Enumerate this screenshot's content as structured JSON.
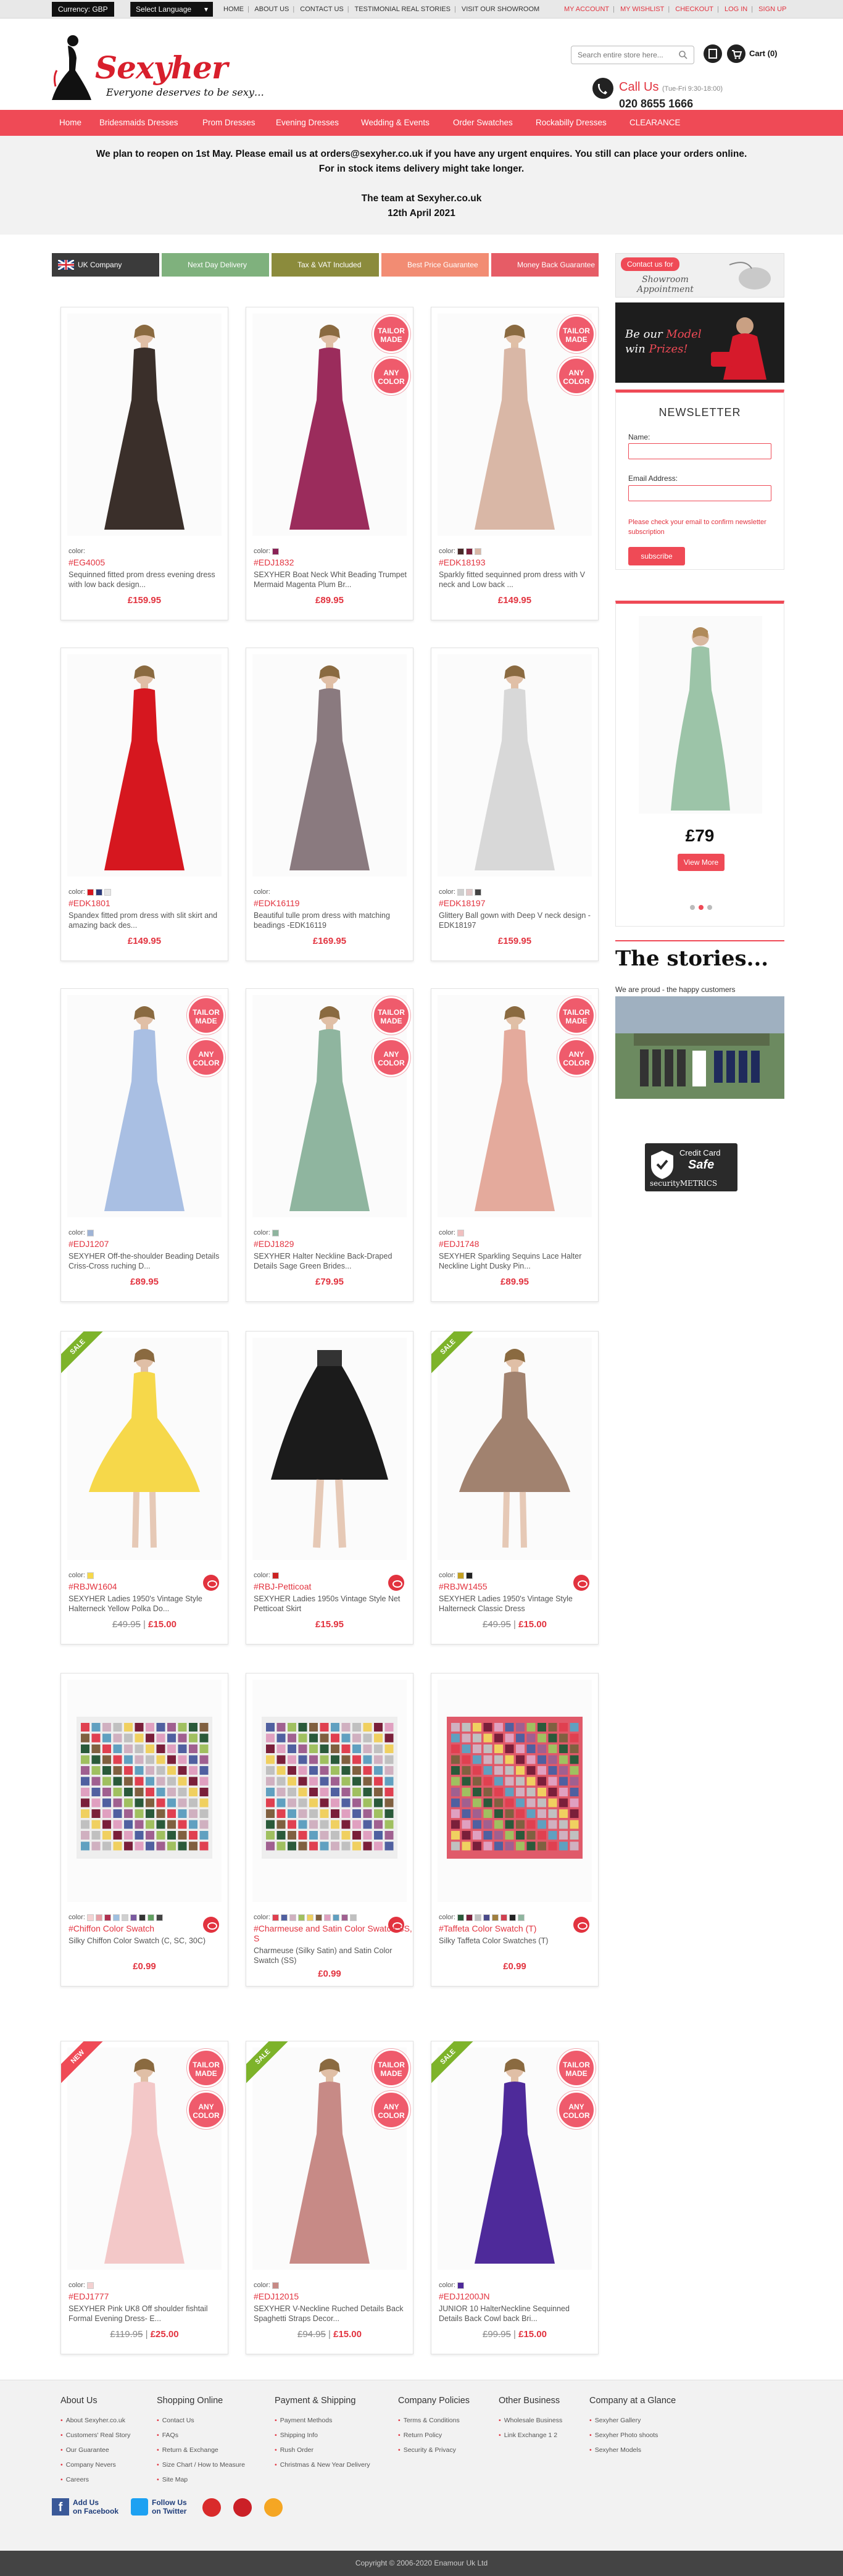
{
  "topbar": {
    "currency": "Currency: GBP",
    "select_language": "Select Language",
    "left_links": [
      "HOME",
      "ABOUT US",
      "CONTACT US",
      "TESTIMONIAL REAL STORIES",
      "VISIT OUR SHOWROOM"
    ],
    "right_links": [
      "MY ACCOUNT",
      "MY WISHLIST",
      "CHECKOUT",
      "LOG IN",
      "SIGN UP"
    ]
  },
  "header": {
    "logo": "Sexyher",
    "tagline": "Everyone deserves to be sexy…",
    "search_placeholder": "Search entire store here...",
    "cart": "Cart (0)",
    "call_us": "Call Us",
    "hours": "(Tue-Fri 9:30-18:00)",
    "phone": "020 8655 1666"
  },
  "nav": [
    "Home",
    "Bridesmaids Dresses",
    "Prom Dresses",
    "Evening Dresses",
    "Wedding & Events",
    "Order Swatches",
    "Rockabilly Dresses",
    "CLEARANCE"
  ],
  "notice": {
    "line1": "We plan to reopen on 1st May. Please email us at orders@sexyher.co.uk if you have any urgent enquires. You still can place your orders online. For in stock items delivery might take longer.",
    "line2": "The team at Sexyher.co.uk",
    "line3": "12th April 2021"
  },
  "badges": [
    {
      "label": "UK Company",
      "color": "#3b3b3b"
    },
    {
      "label": "Next Day Delivery",
      "color": "#7fb17d"
    },
    {
      "label": "Tax & VAT Included",
      "color": "#8b8b3c"
    },
    {
      "label": "Best Price Guarantee",
      "color": "#f28c73"
    },
    {
      "label": "Money Back Guarantee",
      "color": "#e65c66"
    }
  ],
  "labels": {
    "color": "color:",
    "tailor_made": "TAILOR MADE",
    "any_color": "ANY COLOR",
    "sale": "SALE",
    "new": "NEW"
  },
  "products": [
    {
      "code": "#EG4005",
      "desc": "Sequinned fitted prom dress evening dress with low back design...",
      "price": "£159.95",
      "dress": "#3a2f2a",
      "swatches": []
    },
    {
      "code": "#EDJ1832",
      "desc": "SEXYHER Boat Neck Whit Beading Trumpet Mermaid Magenta Plum Br...",
      "price": "£89.95",
      "dress": "#9b2c5c",
      "swatches": [
        "#8b2257"
      ]
    },
    {
      "code": "#EDK18193",
      "desc": "Sparkly fitted sequinned prom dress with V neck and Low back ...",
      "price": "£149.95",
      "dress": "#d9b7a6",
      "swatches": [
        "#4a2a2a",
        "#7a1f3a",
        "#d9b7a6"
      ]
    },
    {
      "code": "#EDK1801",
      "desc": "Spandex fitted prom dress with slit skirt and amazing back des...",
      "price": "£149.95",
      "dress": "#d6171f",
      "swatches": [
        "#d6171f",
        "#2b3a7a",
        "#e6e6e6"
      ]
    },
    {
      "code": "#EDK16119",
      "desc": "Beautiful tulle prom dress with matching beadings -EDK16119",
      "price": "£169.95",
      "dress": "#8a7a7f",
      "swatches": []
    },
    {
      "code": "#EDK18197",
      "desc": "Glittery Ball gown with Deep V neck design - EDK18197",
      "price": "£159.95",
      "dress": "#d8d8d8",
      "swatches": [
        "#cfcfcf",
        "#e2c7c7",
        "#444444"
      ]
    },
    {
      "code": "#EDJ1207",
      "desc": "SEXYHER Off-the-shoulder Beading Details Criss-Cross ruching D...",
      "price": "£89.95",
      "dress": "#a9bfe3",
      "swatches": [
        "#9fb4d6"
      ]
    },
    {
      "code": "#EDJ1829",
      "desc": "SEXYHER Halter Neckline Back-Draped Details Sage Green Brides...",
      "price": "£79.95",
      "dress": "#8fb59f",
      "swatches": [
        "#8fb59f"
      ]
    },
    {
      "code": "#EDJ1748",
      "desc": "SEXYHER Sparkling Sequins Lace Halter Neckline Light Dusky Pin...",
      "price": "£89.95",
      "dress": "#e4aa9c",
      "swatches": [
        "#f0c0c0"
      ]
    },
    {
      "code": "#RBJW1604",
      "desc": "SEXYHER Ladies 1950's Vintage Style Halterneck Yellow Polka Do...",
      "price_old": "£49.95",
      "price": "£15.00",
      "dress": "#f6d84a",
      "swatches": [
        "#f6d84a"
      ]
    },
    {
      "code": "#RBJ-Petticoat",
      "desc": "SEXYHER Ladies 1950s Vintage Style Net Petticoat Skirt",
      "price": "£15.95",
      "dress": "#1b1b1b",
      "swatches": [
        "#cc2222"
      ]
    },
    {
      "code": "#RBJW1455",
      "desc": "SEXYHER Ladies 1950's Vintage Style Halterneck Classic Dress",
      "price_old": "£49.95",
      "price": "£15.00",
      "dress": "#a1826f",
      "swatches": [
        "#c4a020",
        "#222222"
      ]
    },
    {
      "code": "#Chiffon Color Swatch",
      "desc": "Silky Chiffon Color Swatch (C, SC, 30C)",
      "price": "£0.99",
      "swatches": [
        "#f4d3d3",
        "#e8a0a6",
        "#b03050",
        "#9fc0e0",
        "#d0d0d0",
        "#7a5aa0",
        "#333333",
        "#60a060",
        "#444444"
      ]
    },
    {
      "code": "#Charmeuse and Satin Color Swatch SS, S",
      "desc": "Charmeuse (Silky Satin) and Satin Color Swatch (SS)",
      "price": "£0.99",
      "swatches": [
        "#e04050",
        "#5060a0",
        "#d0b0c0",
        "#a0c060",
        "#f0d060",
        "#806040",
        "#e0a0c0",
        "#60a0c0",
        "#a06090",
        "#c0c0c0"
      ]
    },
    {
      "code": "#Taffeta Color Swatch (T)",
      "desc": "Silky Taffeta Color Swatches (T)",
      "price": "£0.99",
      "swatches": [
        "#2a5a3a",
        "#7a1f3a",
        "#c0c0c0",
        "#4a4a8a",
        "#a08040",
        "#d04050",
        "#222222",
        "#8fb59f"
      ]
    },
    {
      "code": "#EDJ1777",
      "desc": "SEXYHER Pink UK8 Off shoulder fishtail Formal Evening Dress- E...",
      "price_old": "£119.95",
      "price": "£25.00",
      "dress": "#f3c8c8",
      "swatches": [
        "#f3d0d0"
      ]
    },
    {
      "code": "#EDJ12015",
      "desc": "SEXYHER V-Neckline Ruched Details Back Spaghetti Straps Decor...",
      "price_old": "£94.95",
      "price": "£15.00",
      "dress": "#c78a86",
      "swatches": [
        "#c78a86"
      ]
    },
    {
      "code": "#EDJ1200JN",
      "desc": "JUNIOR 10 HalterNeckline Sequinned Details Back Cowl back Bri...",
      "price_old": "£99.95",
      "price": "£15.00",
      "dress": "#4e2a9a",
      "swatches": [
        "#4e2a9a"
      ]
    }
  ],
  "sidebar": {
    "contact": "Contact us for",
    "showroom": "Showroom Appointment",
    "model_1": "Be our",
    "model_2": "Model",
    "model_3": "win",
    "model_4": "Prizes!",
    "newsletter": "NEWSLETTER",
    "name_label": "Name:",
    "email_label": "Email Address:",
    "note": "Please check your email to confirm newsletter subscription",
    "subscribe": "subscribe",
    "promo_price": "£79",
    "view_more": "View More",
    "stories_title": "The stories...",
    "stories_sub": "We are proud - the happy customers",
    "credit_1": "Credit Card",
    "credit_2": "Safe",
    "credit_3": "securityMETRICS"
  },
  "footer": {
    "cols": [
      {
        "title": "About Us",
        "links": [
          "About Sexyher.co.uk",
          "Customers' Real Story",
          "Our Guarantee",
          "Company Nevers",
          "Careers"
        ]
      },
      {
        "title": "Shopping Online",
        "links": [
          "Contact Us",
          "FAQs",
          "Return & Exchange",
          "Size Chart / How to Measure",
          "Site Map"
        ]
      },
      {
        "title": "Payment & Shipping",
        "links": [
          "Payment Methods",
          "Shipping Info",
          "Rush Order",
          "Christmas & New Year Delivery"
        ]
      },
      {
        "title": "Company Policies",
        "links": [
          "Terms & Conditions",
          "Return Policy",
          "Security & Privacy"
        ]
      },
      {
        "title": "Other Business",
        "links": [
          "Wholesale Business",
          "Link Exchange 1 2"
        ]
      },
      {
        "title": "Company at a Glance",
        "links": [
          "Sexyher Gallery",
          "Sexyher Photo shoots",
          "Sexyher Models"
        ]
      }
    ],
    "facebook": "Add Us",
    "facebook_2": "on Facebook",
    "twitter": "Follow Us",
    "twitter_2": "on Twitter",
    "copyright": "Copyright © 2006-2020 Enamour Uk Ltd"
  }
}
